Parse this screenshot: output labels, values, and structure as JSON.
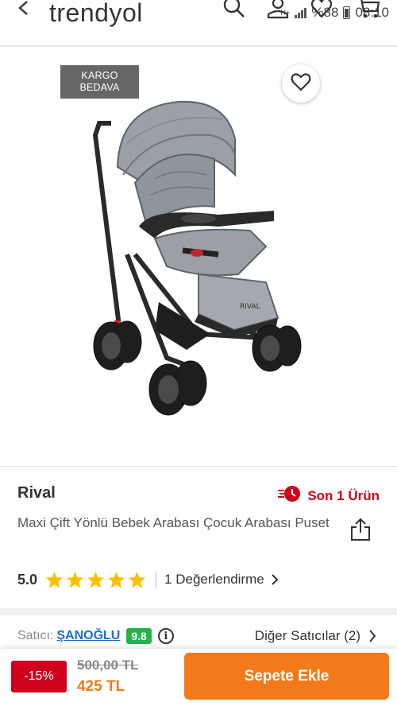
{
  "status_bar": {
    "network": "H+",
    "battery": "%88",
    "time": "08:10"
  },
  "header": {
    "logo_text": "trendyol"
  },
  "product": {
    "badge": "KARGO\nBEDAVA",
    "brand": "Rival",
    "stock_text": "Son 1 Ürün",
    "title": "Maxi Çift Yönlü Bebek Arabası Çocuk Arabası Puset",
    "rating": "5.0",
    "stars": 5,
    "reviews": "1 Değerlendirme"
  },
  "seller": {
    "label": "Satıcı:",
    "name": "ŞANOĞLU",
    "score": "9.8",
    "other_sellers": "Diğer Satıcılar (2)"
  },
  "price": {
    "discount": "-15%",
    "old_price": "500,00 TL",
    "new_price": "425 TL"
  },
  "actions": {
    "add_to_cart": "Sepete Ekle"
  },
  "colors": {
    "brand_orange": "#f27a1a",
    "stock_red": "#d0021b",
    "star_yellow": "#ffc000",
    "seller_blue": "#1a6fc9",
    "score_green": "#27b14a"
  }
}
